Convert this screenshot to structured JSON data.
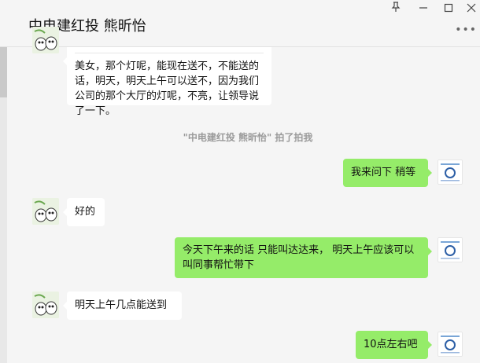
{
  "window": {
    "title": "中电建红投 熊昕怡",
    "pin_icon": "pin-icon",
    "minimize_icon": "minimize-icon",
    "maximize_icon": "maximize-icon",
    "close_icon": "close-icon",
    "more_icon": "more-dots-icon"
  },
  "colors": {
    "self_bubble": "#95ec69",
    "other_bubble": "#ffffff",
    "background": "#f5f5f5"
  },
  "messages": [
    {
      "from": "other",
      "text": "美女，那个灯呢，能现在送不，不能送的话，明天，明天上午可以送不，因为我们公司的那个大厅的灯呢，不亮，让领导说了一下。"
    },
    {
      "from": "system",
      "text": "\"中电建红投 熊昕怡\" 拍了拍我"
    },
    {
      "from": "self",
      "text": "我来问下 稍等"
    },
    {
      "from": "other",
      "text": "好的"
    },
    {
      "from": "self",
      "text": "今天下午来的话 只能叫达达来， 明天上午应该可以叫同事帮忙带下"
    },
    {
      "from": "other",
      "text": "明天上午几点能送到"
    },
    {
      "from": "self",
      "text": "10点左右吧"
    }
  ]
}
